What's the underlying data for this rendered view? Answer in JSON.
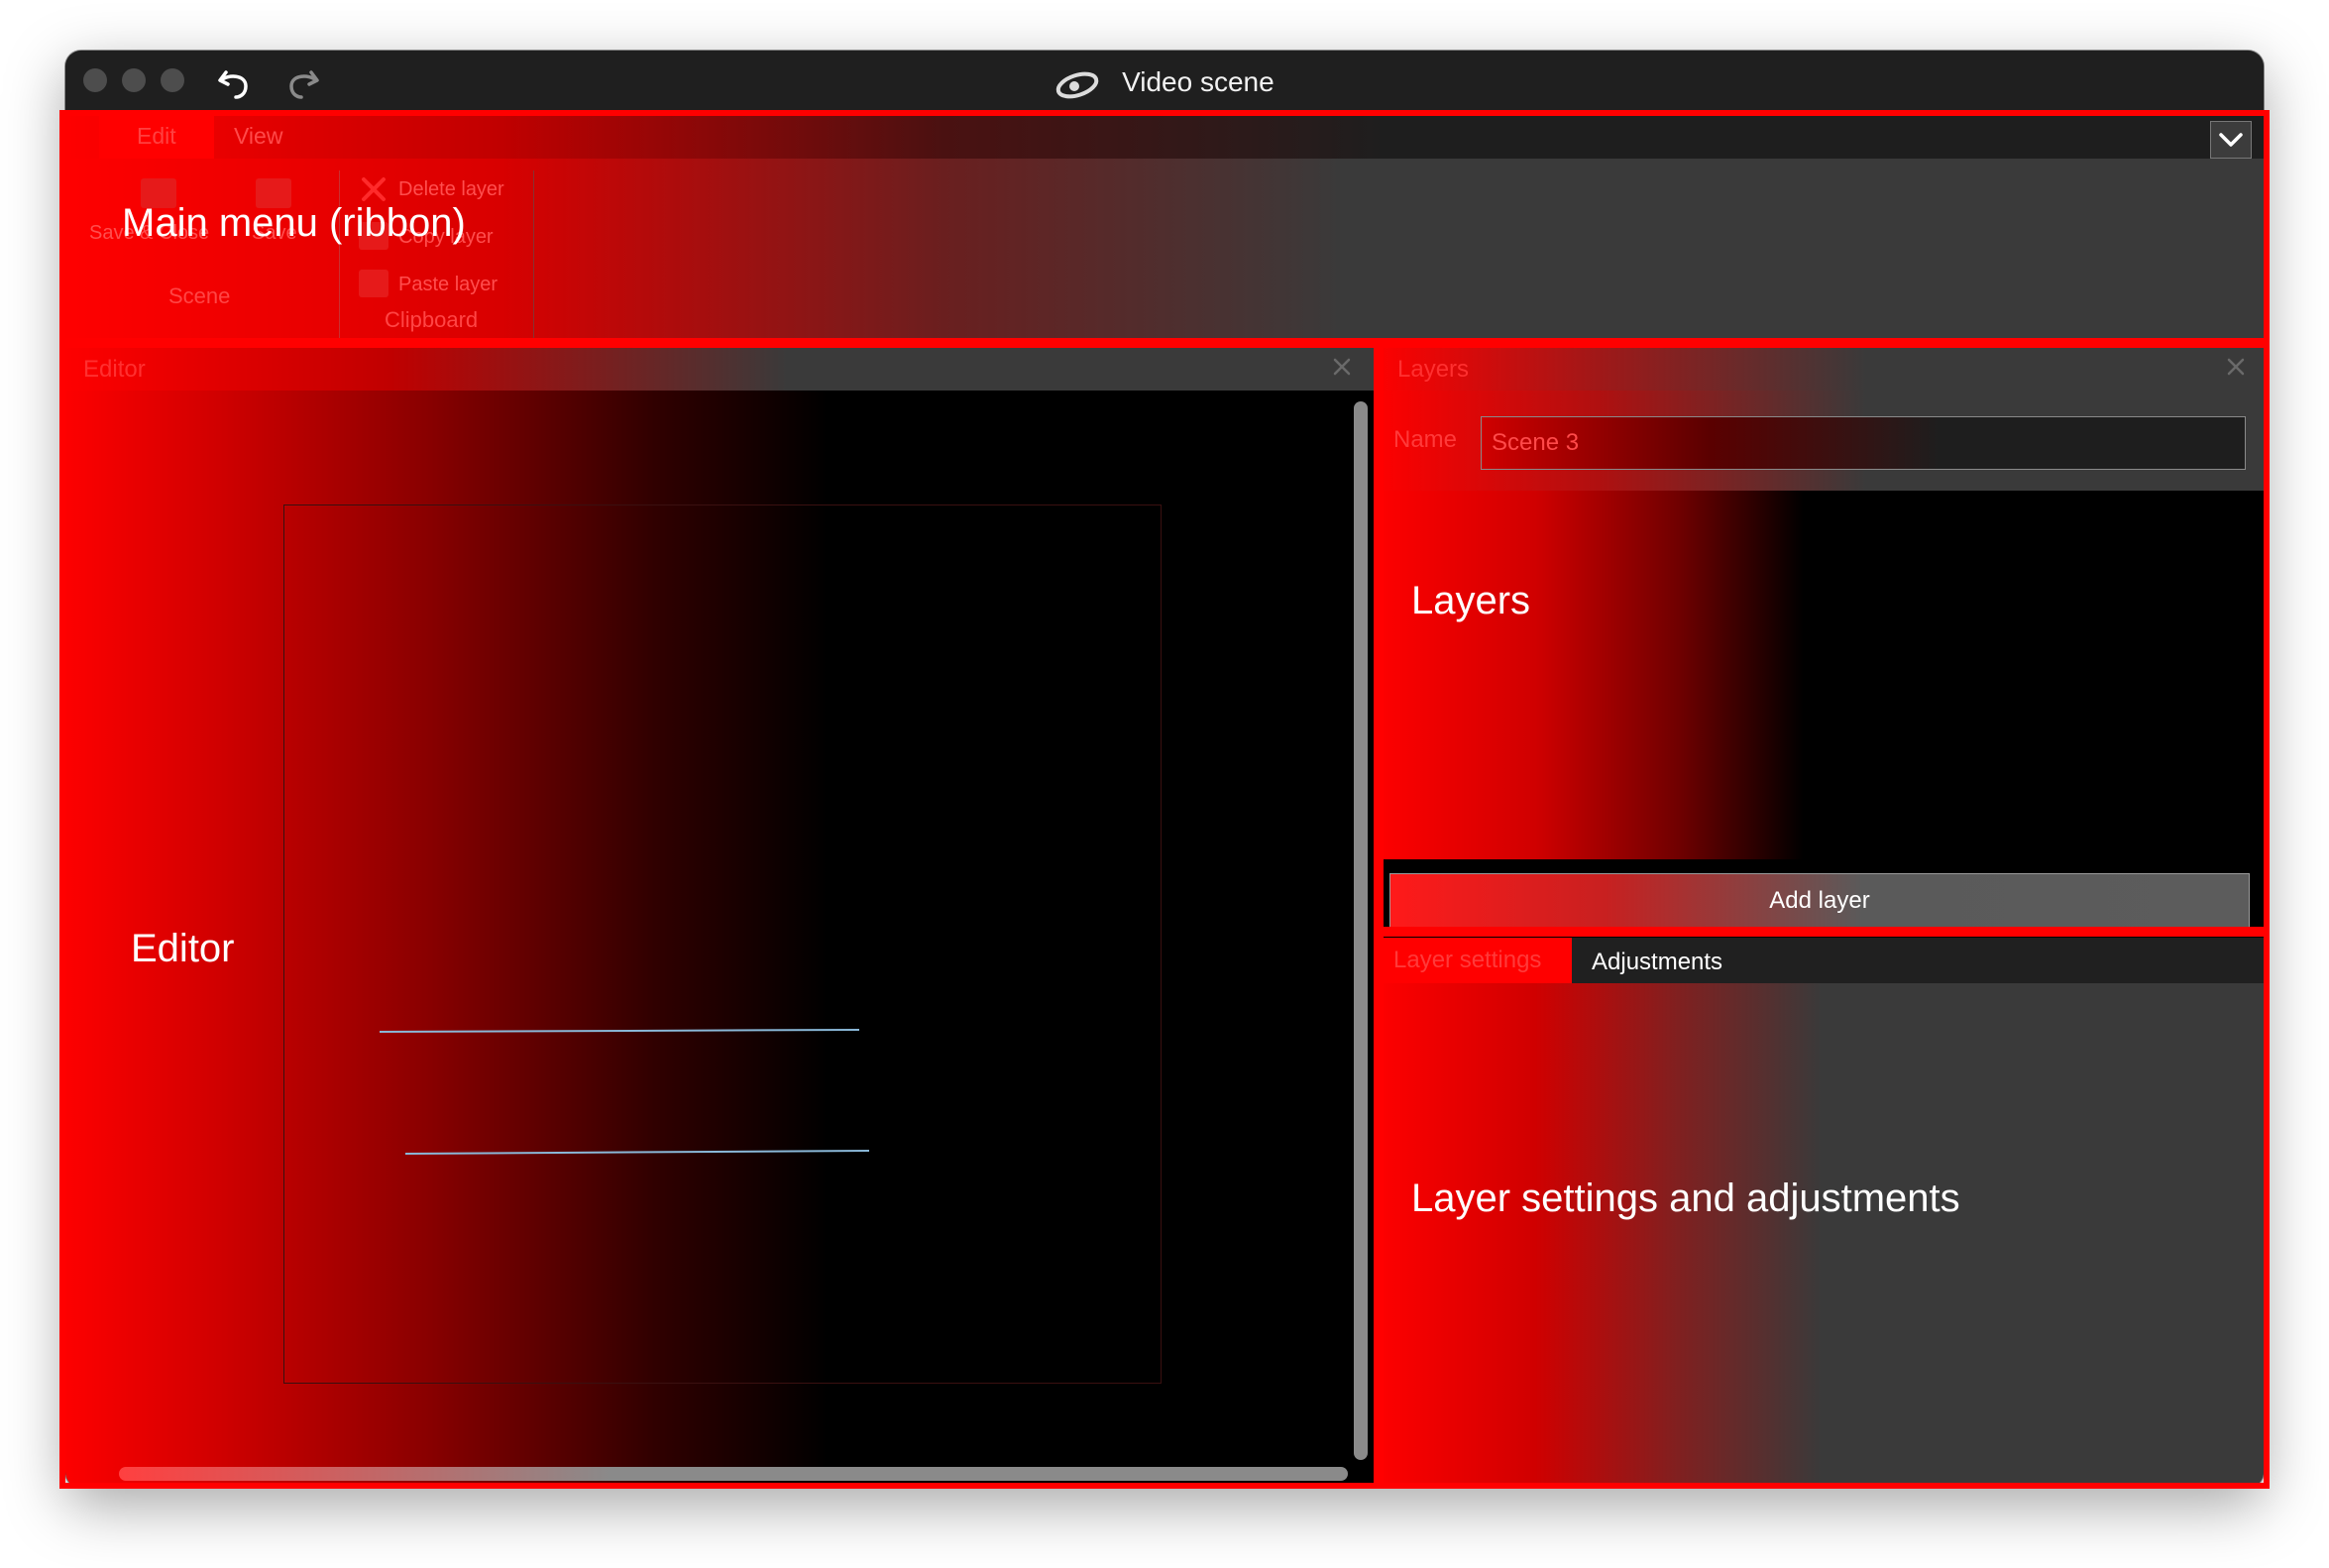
{
  "window": {
    "title": "Video scene"
  },
  "ribbon": {
    "tabs": [
      {
        "label": "Edit",
        "active": true
      },
      {
        "label": "View",
        "active": false
      }
    ],
    "scene_group": {
      "label": "Scene",
      "buttons": [
        {
          "label": "Save & Close",
          "icon": "save-close-icon"
        },
        {
          "label": "Save",
          "icon": "save-icon"
        }
      ]
    },
    "clipboard_group": {
      "label": "Clipboard",
      "buttons": [
        {
          "label": "Delete layer",
          "icon": "delete-icon"
        },
        {
          "label": "Copy layer",
          "icon": "copy-icon"
        },
        {
          "label": "Paste layer",
          "icon": "paste-icon"
        }
      ]
    }
  },
  "editor": {
    "title": "Editor"
  },
  "layers": {
    "title": "Layers",
    "name_label": "Name",
    "name_value": "Scene 3",
    "add_button": "Add layer"
  },
  "settings": {
    "tabs": [
      {
        "label": "Layer settings",
        "active": true
      },
      {
        "label": "Adjustments",
        "active": false
      }
    ]
  },
  "annotations": {
    "ribbon": "Main menu (ribbon)",
    "editor": "Editor",
    "layers": "Layers",
    "settings": "Layer settings and adjustments"
  },
  "colors": {
    "highlight": "#ff0000",
    "window_bg": "#2b2b2b",
    "titlebar_bg": "#1f1f1f"
  }
}
